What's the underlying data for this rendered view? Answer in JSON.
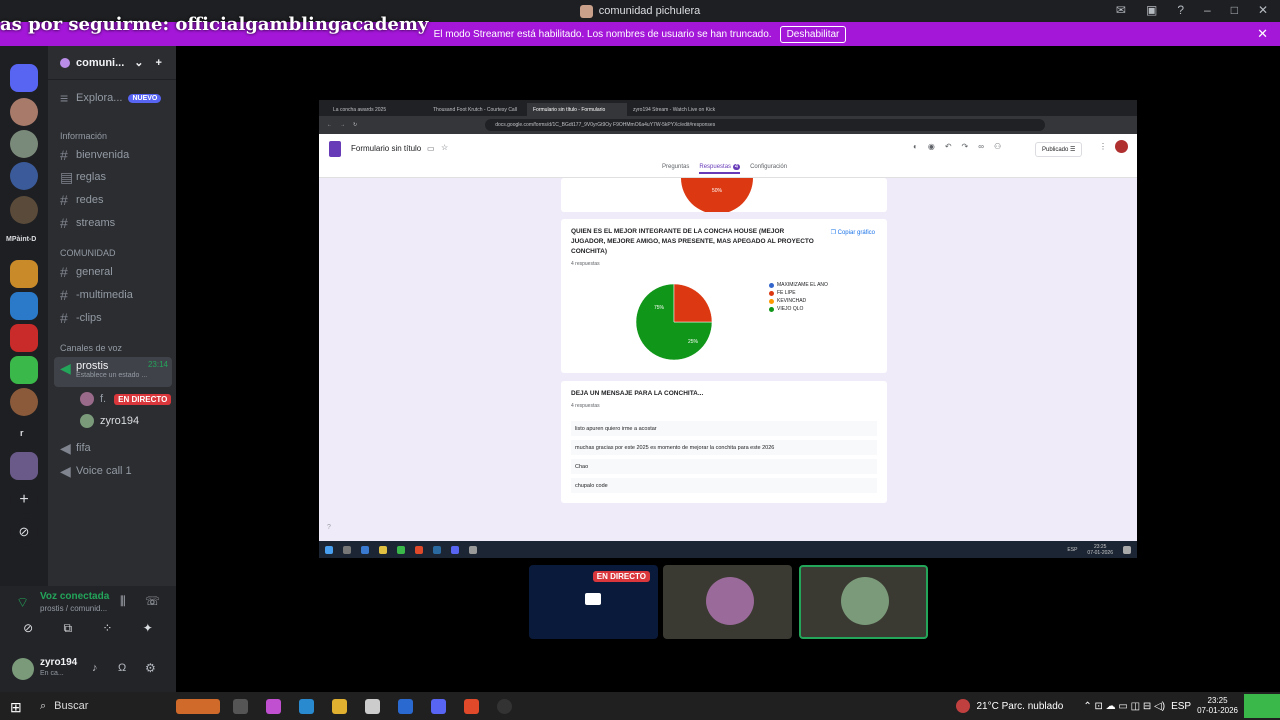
{
  "window": {
    "title": "comunidad pichulera"
  },
  "overlay": {
    "text": "as por seguirme: officialgamblingacademy"
  },
  "banner": {
    "text": "El modo Streamer está habilitado. Los nombres de usuario se han truncado.",
    "button": "Deshabilitar"
  },
  "rail": {
    "label_mpaint": "MPàint-D",
    "label_r": "r"
  },
  "guild": {
    "name": "comuni..."
  },
  "channels": {
    "explore": "Explora...",
    "explore_badge": "NUEVO",
    "cat_info": "Información",
    "bienvenida": "bienvenida",
    "reglas": "reglas",
    "redes": "redes",
    "streams": "streams",
    "cat_comunidad": "COMUNIDAD",
    "general": "general",
    "multimedia": "-multimedia",
    "clips": "-clips",
    "cat_voice": "Canales de voz",
    "prostis": "prostis",
    "prostis_time": "23:14",
    "prostis_status": "Establece un estado ...",
    "member1": "f.",
    "member1_live": "EN DIRECTO",
    "member2": "zyro194",
    "fifa": "fifa",
    "voicecall": "Voice call 1"
  },
  "voice": {
    "status": "Voz conectada",
    "channel": "prostis / comunid...",
    "username": "zyro194",
    "userstatus": "En ca..."
  },
  "browser": {
    "tabs": [
      "La concha awards 2025",
      "Thousand Foot Krutch - Courtesy Call",
      "Formulario sin título - Formulario",
      "zyro194 Stream - Watch Live on Kick"
    ],
    "url": "docs.google.com/forms/d/1C_BGdt177_9V0yrGt9Oy F9OHMmO6a4uY7W-5kPYXc/edit#responses",
    "form_title": "Formulario sin título",
    "tab_preguntas": "Preguntas",
    "tab_respuestas": "Respuestas",
    "respuestas_count": "4",
    "tab_config": "Configuración",
    "published": "Publicado"
  },
  "q_prev": {
    "label": "50%"
  },
  "q1": {
    "title": "QUIEN ES EL MEJOR INTEGRANTE DE LA CONCHA HOUSE (MEJOR JUGADOR, MEJORE AMIGO, MAS PRESENTE, MAS APEGADO AL PROYECTO CONCHITA)",
    "count": "4 respuestas",
    "copy": "Copiar gráfico",
    "legend": [
      "MAXIMIZAME EL ANO",
      "FE LIPE",
      "KEVINCHAD",
      "VIEJO QLO"
    ],
    "colors": [
      "#3366cc",
      "#dc3912",
      "#ff9900",
      "#109618"
    ],
    "slice_green": "75%",
    "slice_red": "25%"
  },
  "chart_data": {
    "type": "pie",
    "categories": [
      "MAXIMIZAME EL ANO",
      "FE LIPE",
      "KEVINCHAD",
      "VIEJO QLO"
    ],
    "values": [
      0,
      25,
      0,
      75
    ],
    "title": "QUIEN ES EL MEJOR INTEGRANTE DE LA CONCHA HOUSE (MEJOR JUGADOR, MEJORE AMIGO, MAS PRESENTE, MAS APEGADO AL PROYECTO CONCHITA)"
  },
  "q2": {
    "title": "DEJA UN MENSAJE PARA LA CONCHITA...",
    "count": "4 respuestas",
    "responses": [
      "listo apuren quiero irme a acostar",
      "muchas gracias por este 2025 es momento de mejorar la conchita para este 2026",
      "Chao",
      "chupalo code"
    ]
  },
  "inner_taskbar": {
    "time": "23:25",
    "date": "07-01-2026",
    "lang": "ESP"
  },
  "tile1": {
    "live": "EN DIRECTO"
  },
  "taskbar": {
    "search": "Buscar",
    "weather": "21°C  Parc. nublado",
    "lang": "ESP",
    "time": "23:25",
    "date": "07-01-2026"
  }
}
